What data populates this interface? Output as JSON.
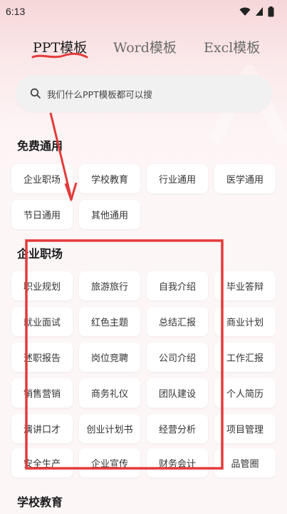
{
  "status": {
    "time": "6:13",
    "icons": [
      "wifi-icon",
      "signal-icon",
      "battery-icon"
    ]
  },
  "tabs": [
    {
      "label": "PPT模板",
      "active": true
    },
    {
      "label": "Word模板",
      "active": false
    },
    {
      "label": "Excl模板",
      "active": false
    }
  ],
  "search": {
    "placeholder": "我们什么PPT模板都可以搜"
  },
  "sections": [
    {
      "title": "免费通用",
      "items": [
        "企业职场",
        "学校教育",
        "行业通用",
        "医学通用",
        "节日通用",
        "其他通用"
      ]
    },
    {
      "title": "企业职场",
      "items": [
        "职业规划",
        "旅游旅行",
        "自我介绍",
        "毕业答辩",
        "就业面试",
        "红色主题",
        "总结汇报",
        "商业计划",
        "述职报告",
        "岗位竞聘",
        "公司介绍",
        "工作汇报",
        "销售营销",
        "商务礼仪",
        "团队建设",
        "个人简历",
        "演讲口才",
        "创业计划书",
        "经营分析",
        "项目管理",
        "安全生产",
        "企业宣传",
        "财务会计",
        "品管圈"
      ]
    },
    {
      "title": "学校教育",
      "items": []
    }
  ],
  "colors": {
    "accent_red": "#e43b3b",
    "chip_bg": "#ffffff",
    "search_bg": "#f1f1f1"
  }
}
